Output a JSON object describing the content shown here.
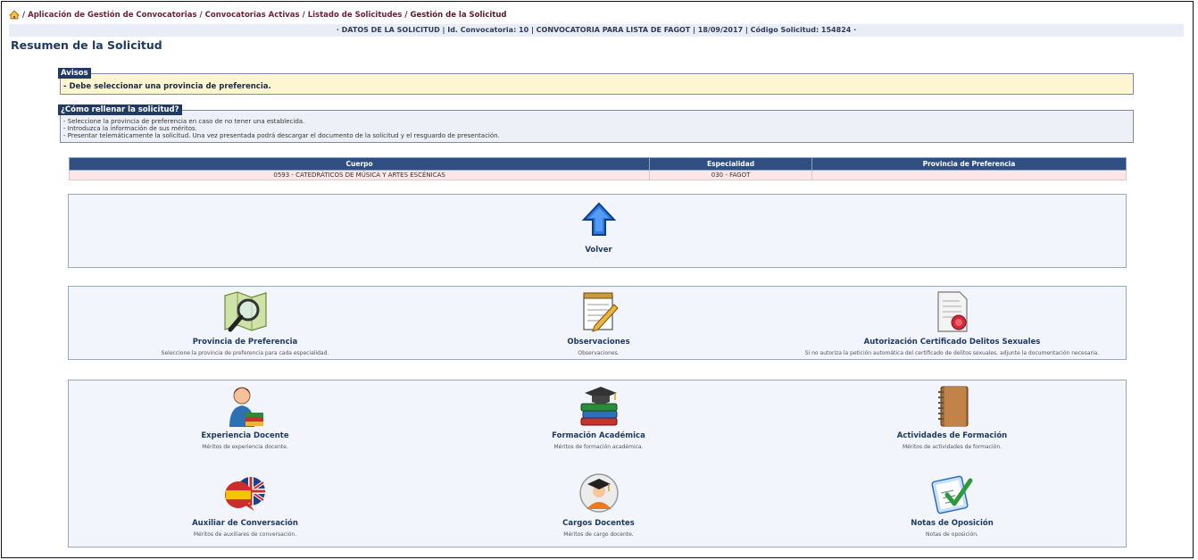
{
  "breadcrumbs": {
    "items": [
      "Aplicación de Gestión de Convocatorias",
      "Convocatorias Activas",
      "Listado de Solicitudes",
      "Gestión de la Solicitud"
    ]
  },
  "info_bar": "· DATOS DE LA SOLICITUD | Id. Convocatoria: 10 | CONVOCATORIA PARA LISTA DE FAGOT | 18/09/2017 | Código Solicitud: 154824 ·",
  "page_title": "Resumen de la Solicitud",
  "avisos": {
    "legend": "Avisos",
    "message": "- Debe seleccionar una provincia de preferencia."
  },
  "como": {
    "legend": "¿Cómo rellenar la solicitud?",
    "lines": [
      "- Seleccione la provincia de preferencia en caso de no tener una establecida.",
      "- Introduzca la información de sus méritos.",
      "- Presentar telemáticamente la solicitud. Una vez presentada podrá descargar el documento de la solicitud y el resguardo de presentación."
    ]
  },
  "table": {
    "headers": [
      "Cuerpo",
      "Especialidad",
      "Provincia de Preferencia"
    ],
    "rows": [
      [
        "0593 - CATEDRÁTICOS DE MÚSICA Y ARTES ESCÉNICAS",
        "030 - FAGOT",
        ""
      ]
    ]
  },
  "volver": {
    "label": "Volver"
  },
  "tiles": [
    {
      "title": "Provincia de Preferencia",
      "desc": "Seleccione la provincia de preferencia para cada especialidad.",
      "icon": "map-magnifier-icon"
    },
    {
      "title": "Observaciones",
      "desc": "Observaciones.",
      "icon": "notepad-pencil-icon"
    },
    {
      "title": "Autorización Certificado Delitos Sexuales",
      "desc": "Si no autoriza la petición automática del certificado de delitos sexuales, adjunte la documentación necesaria.",
      "icon": "certificate-seal-icon"
    },
    {
      "title": "Experiencia Docente",
      "desc": "Méritos de experiencia docente.",
      "icon": "teacher-icon"
    },
    {
      "title": "Formación Académica",
      "desc": "Méritos de formación académica.",
      "icon": "books-graduation-icon"
    },
    {
      "title": "Actividades de Formación",
      "desc": "Méritos de actividades de formación.",
      "icon": "notebook-icon"
    },
    {
      "title": "Auxiliar de Conversación",
      "desc": "Méritos de auxiliares de conversación.",
      "icon": "language-flags-icon"
    },
    {
      "title": "Cargos Docentes",
      "desc": "Méritos de cargo docente.",
      "icon": "graduate-avatar-icon"
    },
    {
      "title": "Notas de Oposición",
      "desc": "Notas de oposición.",
      "icon": "checklist-icon"
    }
  ]
}
